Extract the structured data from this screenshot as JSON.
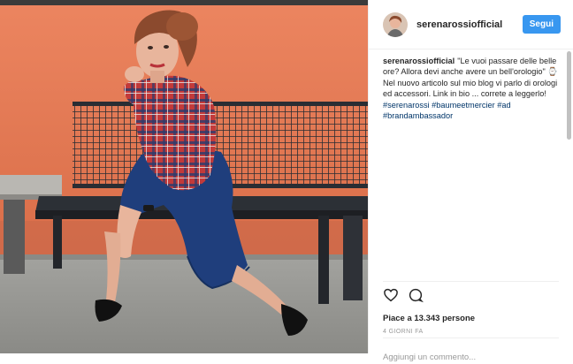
{
  "post": {
    "username": "serenarossiofficial",
    "follow_label": "Segui",
    "caption": {
      "username": "serenarossiofficial",
      "text": "\"Le vuoi passare delle belle ore? Allora devi anche avere un bell'orologio\" ⌚ Nel nuovo articolo sul mio blog vi parlo di orologi ed accessori. Link in bio ... correte a leggerlo!",
      "hashtags": [
        "#serenarossi",
        "#baumeetmercier",
        "#ad",
        "#brandambassador"
      ]
    },
    "likes": "Piace a 13.343 persone",
    "time": "4 GIORNI FA",
    "comment_placeholder": "Aggiungi un commento..."
  },
  "icons": [
    "heart-icon",
    "comment-icon"
  ],
  "colors": {
    "accent": "#3897f0",
    "hashtag": "#003569",
    "wall": "#e27a55"
  }
}
